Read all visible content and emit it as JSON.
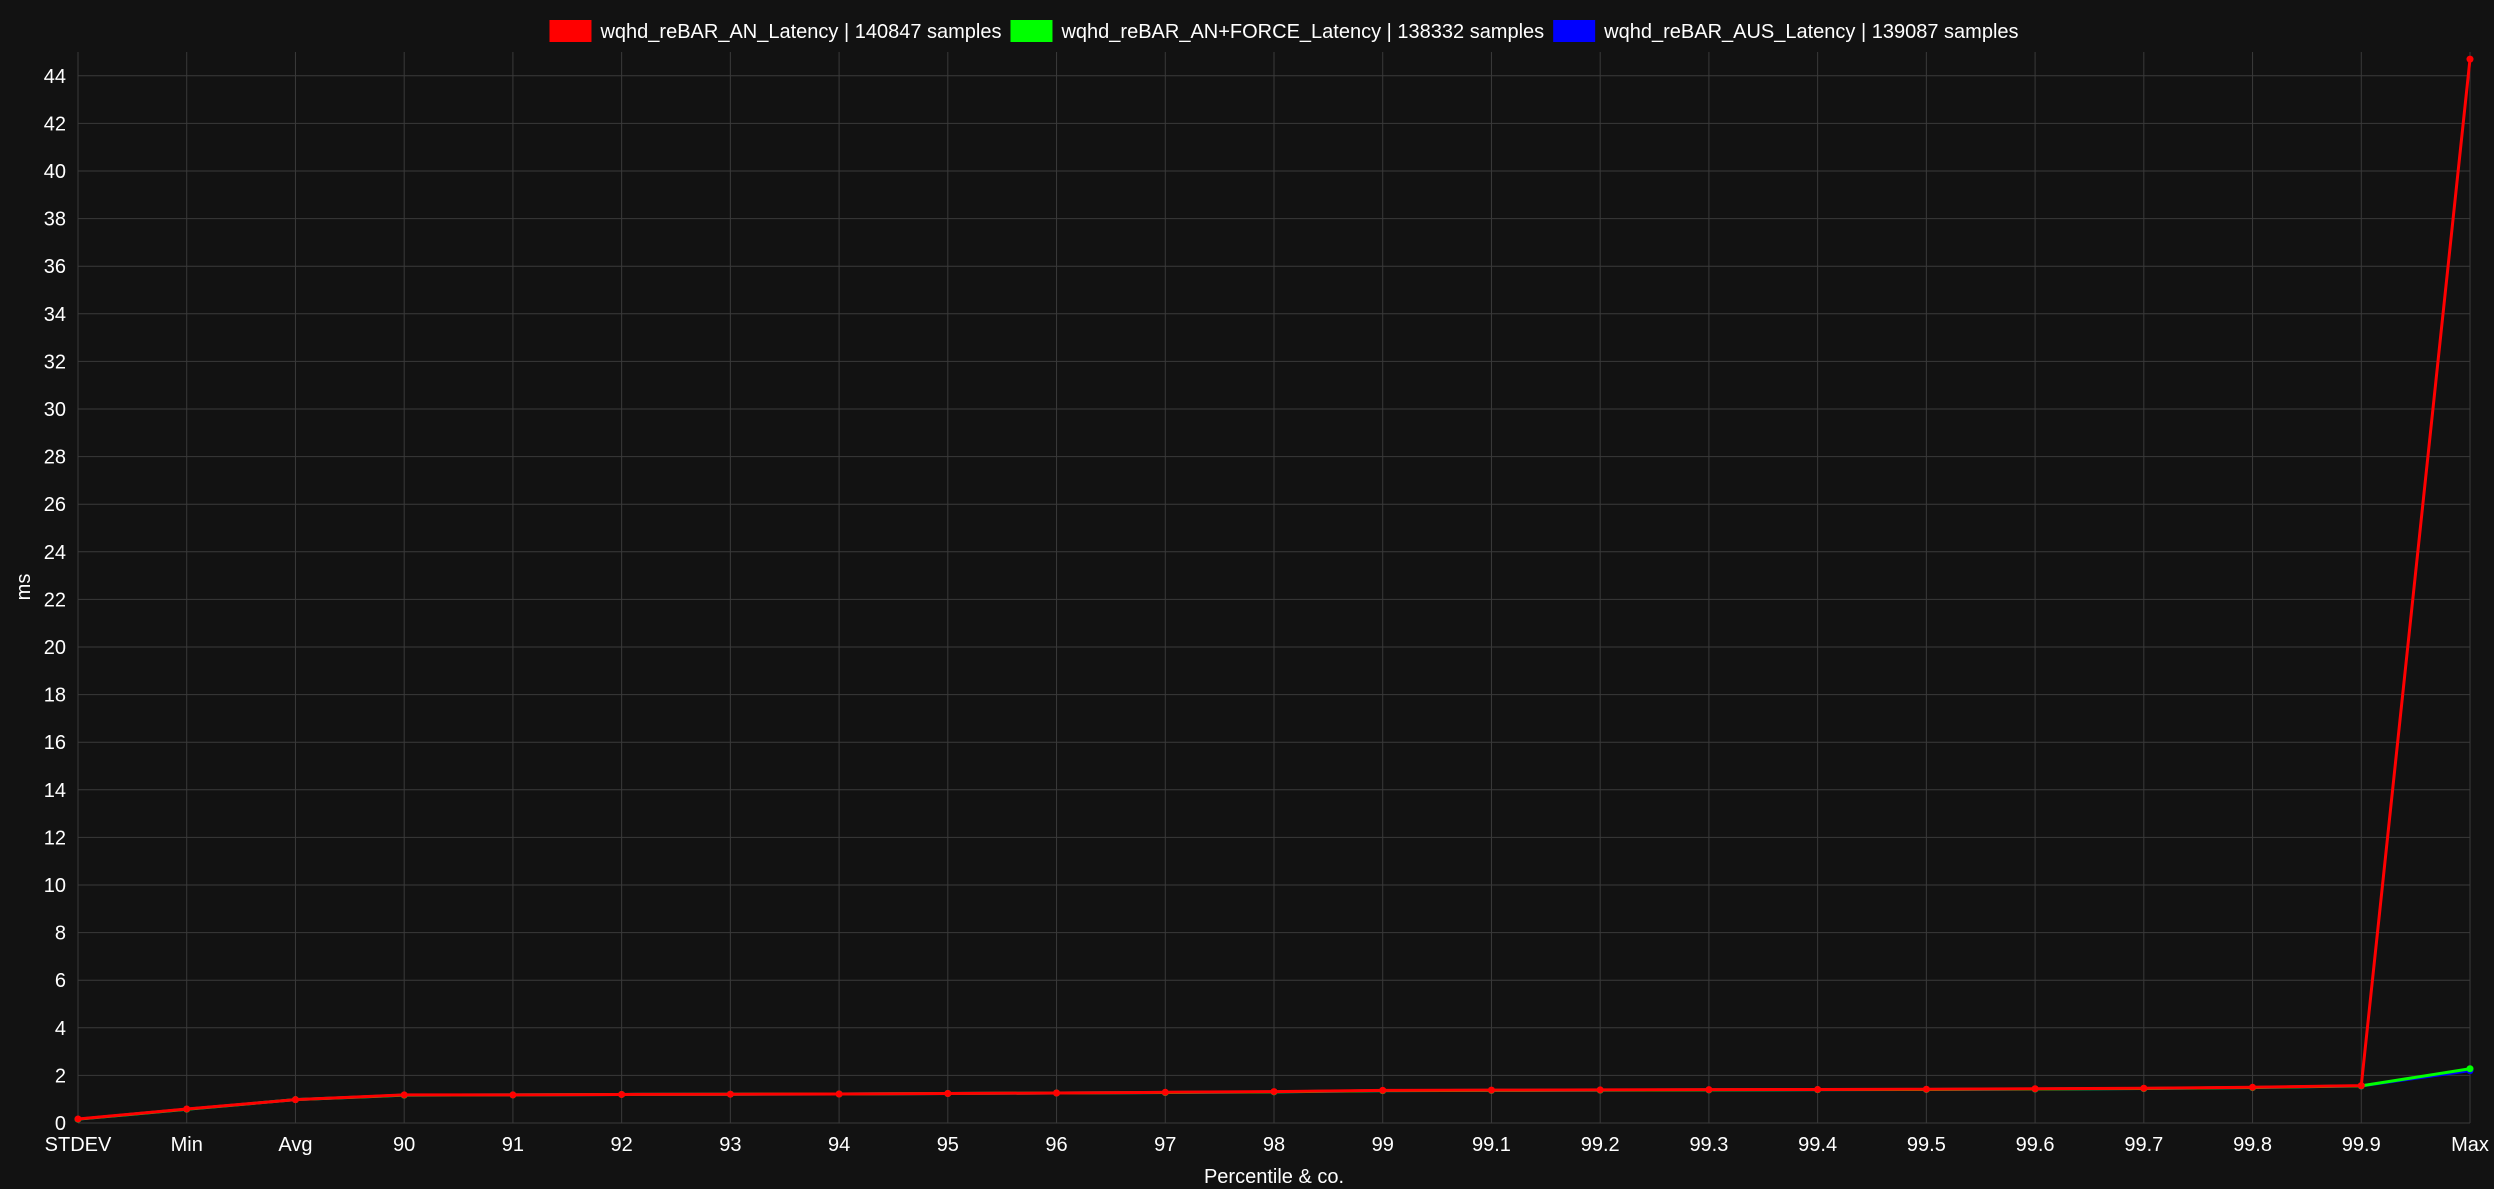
{
  "chart_data": {
    "type": "line",
    "title": "",
    "xlabel": "Percentile & co.",
    "ylabel": "ms",
    "ylim": [
      0,
      45
    ],
    "yticks": [
      0,
      2,
      4,
      6,
      8,
      10,
      12,
      14,
      16,
      18,
      20,
      22,
      24,
      26,
      28,
      30,
      32,
      34,
      36,
      38,
      40,
      42,
      44
    ],
    "grid": true,
    "legend_position": "top-center",
    "categories": [
      "STDEV",
      "Min",
      "Avg",
      "90",
      "91",
      "92",
      "93",
      "94",
      "95",
      "96",
      "97",
      "98",
      "99",
      "99.1",
      "99.2",
      "99.3",
      "99.4",
      "99.5",
      "99.6",
      "99.7",
      "99.8",
      "99.9",
      "Max"
    ],
    "series": [
      {
        "name": "wqhd_reBAR_AUS_Latency | 139087 samples",
        "color": "#0000ff",
        "values": [
          0.16,
          0.58,
          0.98,
          1.17,
          1.18,
          1.2,
          1.21,
          1.22,
          1.24,
          1.26,
          1.28,
          1.31,
          1.36,
          1.37,
          1.38,
          1.39,
          1.4,
          1.41,
          1.43,
          1.45,
          1.49,
          1.56,
          2.2
        ]
      },
      {
        "name": "wqhd_reBAR_AN+FORCE_Latency | 138332 samples",
        "color": "#00ff00",
        "values": [
          0.16,
          0.58,
          0.98,
          1.17,
          1.18,
          1.2,
          1.21,
          1.22,
          1.24,
          1.26,
          1.28,
          1.31,
          1.36,
          1.37,
          1.38,
          1.39,
          1.4,
          1.41,
          1.43,
          1.45,
          1.49,
          1.56,
          2.28
        ]
      },
      {
        "name": "wqhd_reBAR_AN_Latency | 140847 samples",
        "color": "#ff0000",
        "values": [
          0.17,
          0.59,
          0.98,
          1.18,
          1.18,
          1.2,
          1.21,
          1.22,
          1.24,
          1.26,
          1.29,
          1.32,
          1.37,
          1.38,
          1.39,
          1.4,
          1.41,
          1.42,
          1.44,
          1.46,
          1.5,
          1.57,
          44.7
        ]
      }
    ],
    "legend_order": [
      2,
      1,
      0
    ]
  }
}
